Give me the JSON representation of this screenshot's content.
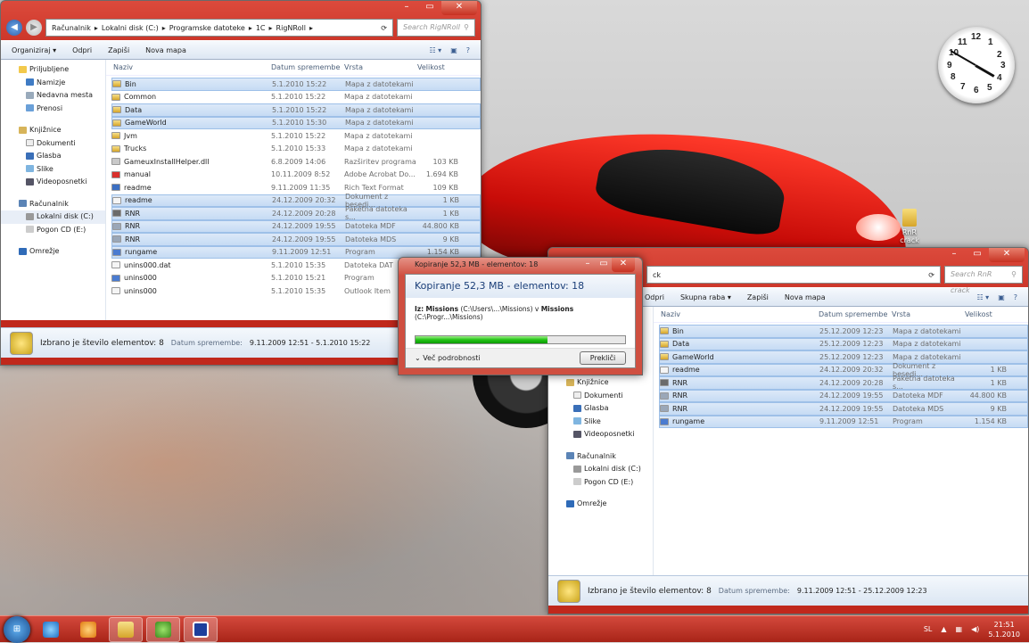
{
  "colors": {
    "accent": "#c0281c",
    "selection": "#c6dbf4",
    "progress": "#22c315"
  },
  "desktop": {
    "icon_label": "RnR crack",
    "clock": {
      "n12": "12",
      "n1": "1",
      "n2": "2",
      "n3": "3",
      "n4": "4",
      "n5": "5",
      "n6": "6",
      "n7": "7",
      "n8": "8",
      "n9": "9",
      "n10": "10",
      "n11": "11"
    }
  },
  "window1": {
    "breadcrumb": [
      "Računalnik",
      "Lokalni disk (C:)",
      "Programske datoteke",
      "1C",
      "RigNRoll"
    ],
    "search_placeholder": "Search RigNRoll",
    "toolbar": {
      "organize": "Organiziraj ▾",
      "open": "Odpri",
      "burn": "Zapiši",
      "new_folder": "Nova mapa"
    },
    "columns": {
      "name": "Naziv",
      "date": "Datum spremembe",
      "type": "Vrsta",
      "size": "Velikost"
    },
    "nav": {
      "fav": "Priljubljene",
      "desktop": "Namizje",
      "recent": "Nedavna mesta",
      "downloads": "Prenosi",
      "libs": "Knjižnice",
      "docs": "Dokumenti",
      "music": "Glasba",
      "pics": "Slike",
      "videos": "Videoposnetki",
      "computer": "Računalnik",
      "disk_c": "Lokalni disk (C:)",
      "drive_e": "Pogon CD (E:)",
      "network": "Omrežje"
    },
    "files": [
      {
        "name": "Bin",
        "date": "5.1.2010 15:22",
        "type": "Mapa z datotekami",
        "size": "",
        "sel": true,
        "icon": "folder"
      },
      {
        "name": "Common",
        "date": "5.1.2010 15:22",
        "type": "Mapa z datotekami",
        "size": "",
        "sel": false,
        "icon": "folder"
      },
      {
        "name": "Data",
        "date": "5.1.2010 15:22",
        "type": "Mapa z datotekami",
        "size": "",
        "sel": true,
        "icon": "folder"
      },
      {
        "name": "GameWorld",
        "date": "5.1.2010 15:30",
        "type": "Mapa z datotekami",
        "size": "",
        "sel": true,
        "icon": "folder"
      },
      {
        "name": "Jvm",
        "date": "5.1.2010 15:22",
        "type": "Mapa z datotekami",
        "size": "",
        "sel": false,
        "icon": "folder"
      },
      {
        "name": "Trucks",
        "date": "5.1.2010 15:33",
        "type": "Mapa z datotekami",
        "size": "",
        "sel": false,
        "icon": "folder"
      },
      {
        "name": "GameuxInstallHelper.dll",
        "date": "6.8.2009 14:06",
        "type": "Razširitev programa",
        "size": "103 KB",
        "sel": false,
        "icon": "dll"
      },
      {
        "name": "manual",
        "date": "10.11.2009 8:52",
        "type": "Adobe Acrobat Do...",
        "size": "1.694 KB",
        "sel": false,
        "icon": "pdf"
      },
      {
        "name": "readme",
        "date": "9.11.2009 11:35",
        "type": "Rich Text Format",
        "size": "109 KB",
        "sel": false,
        "icon": "doc"
      },
      {
        "name": "readme",
        "date": "24.12.2009 20:32",
        "type": "Dokument z besedi...",
        "size": "1 KB",
        "sel": true,
        "icon": "txt"
      },
      {
        "name": "RNR",
        "date": "24.12.2009 20:28",
        "type": "Paketna datoteka s...",
        "size": "1 KB",
        "sel": true,
        "icon": "bat"
      },
      {
        "name": "RNR",
        "date": "24.12.2009 19:55",
        "type": "Datoteka MDF",
        "size": "44.800 KB",
        "sel": true,
        "icon": "mdf"
      },
      {
        "name": "RNR",
        "date": "24.12.2009 19:55",
        "type": "Datoteka MDS",
        "size": "9 KB",
        "sel": true,
        "icon": "mdf"
      },
      {
        "name": "rungame",
        "date": "9.11.2009 12:51",
        "type": "Program",
        "size": "1.154 KB",
        "sel": true,
        "icon": "exe"
      },
      {
        "name": "unins000.dat",
        "date": "5.1.2010 15:35",
        "type": "Datoteka DAT",
        "size": "",
        "sel": false,
        "icon": "txt"
      },
      {
        "name": "unins000",
        "date": "5.1.2010 15:21",
        "type": "Program",
        "size": "",
        "sel": false,
        "icon": "exe"
      },
      {
        "name": "unins000",
        "date": "5.1.2010 15:35",
        "type": "Outlook Item",
        "size": "",
        "sel": false,
        "icon": "txt"
      }
    ],
    "status": {
      "count": "Izbrano je število elementov: 8",
      "date_label": "Datum spremembe:",
      "date_value": "9.11.2009 12:51 - 5.1.2010 15:22"
    }
  },
  "window2": {
    "addr_tail": "ck",
    "search_placeholder": "Search RnR crack",
    "toolbar": {
      "open": "Odpri",
      "share": "Skupna raba ▾",
      "burn": "Zapiši",
      "new_folder": "Nova mapa"
    },
    "columns": {
      "name": "Naziv",
      "date": "Datum spremembe",
      "type": "Vrsta",
      "size": "Velikost"
    },
    "nav": {
      "libs": "Knjižnice",
      "docs": "Dokumenti",
      "music": "Glasba",
      "pics": "Slike",
      "videos": "Videoposnetki",
      "computer": "Računalnik",
      "disk_c": "Lokalni disk (C:)",
      "drive_e": "Pogon CD (E:)",
      "network": "Omrežje"
    },
    "files": [
      {
        "name": "Bin",
        "date": "25.12.2009 12:23",
        "type": "Mapa z datotekami",
        "size": "",
        "icon": "folder"
      },
      {
        "name": "Data",
        "date": "25.12.2009 12:23",
        "type": "Mapa z datotekami",
        "size": "",
        "icon": "folder"
      },
      {
        "name": "GameWorld",
        "date": "25.12.2009 12:23",
        "type": "Mapa z datotekami",
        "size": "",
        "icon": "folder"
      },
      {
        "name": "readme",
        "date": "24.12.2009 20:32",
        "type": "Dokument z besedi...",
        "size": "1 KB",
        "icon": "txt"
      },
      {
        "name": "RNR",
        "date": "24.12.2009 20:28",
        "type": "Paketna datoteka s...",
        "size": "1 KB",
        "icon": "bat"
      },
      {
        "name": "RNR",
        "date": "24.12.2009 19:55",
        "type": "Datoteka MDF",
        "size": "44.800 KB",
        "icon": "mdf"
      },
      {
        "name": "RNR",
        "date": "24.12.2009 19:55",
        "type": "Datoteka MDS",
        "size": "9 KB",
        "icon": "mdf"
      },
      {
        "name": "rungame",
        "date": "9.11.2009 12:51",
        "type": "Program",
        "size": "1.154 KB",
        "icon": "exe"
      }
    ],
    "status": {
      "count": "Izbrano je število elementov: 8",
      "date_label": "Datum spremembe:",
      "date_value": "9.11.2009 12:51 - 25.12.2009 12:23"
    }
  },
  "dialog": {
    "title": "Kopiranje 52,3 MB - elementov: 18",
    "heading": "Kopiranje 52,3 MB - elementov: 18",
    "from_label": "Iz:",
    "from_name": "Missions",
    "from_path": "(C:\\Users\\...\\Missions) v",
    "to_name": "Missions",
    "to_path": "(C:\\Progr...\\Missions)",
    "progress": 0.63,
    "more": "Več podrobnosti",
    "cancel": "Prekliči"
  },
  "taskbar": {
    "lang": "SL",
    "time": "21:51",
    "date": "5.1.2010"
  }
}
